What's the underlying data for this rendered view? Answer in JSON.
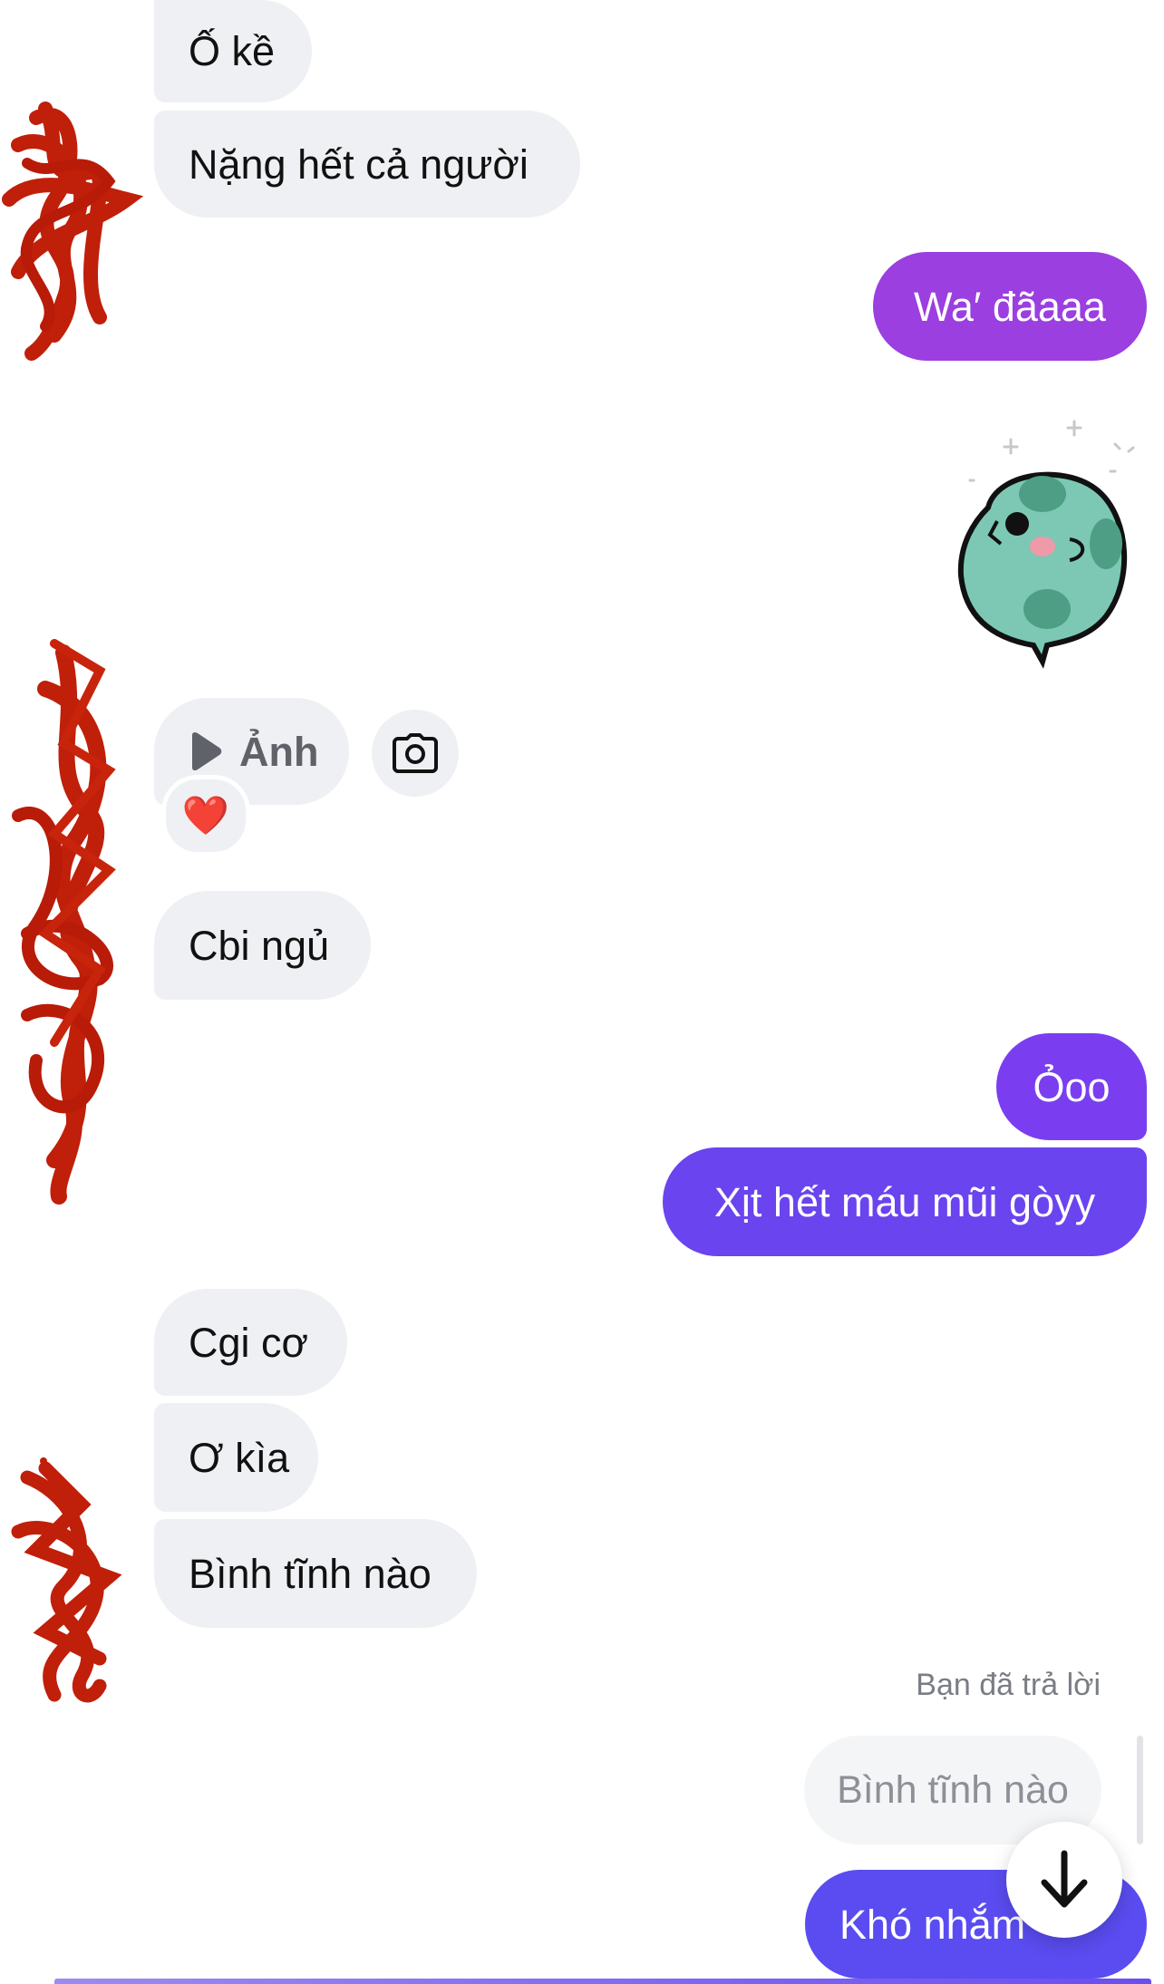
{
  "messages": {
    "m1": "Ố kề",
    "m2": "Nặng hết cả người",
    "m3": "Wa′ đãaaa",
    "m4_label": "Ảnh",
    "m5": "Cbi ngủ",
    "m6": "Ỏoo",
    "m7": "Xịt hết máu mũi gòyy",
    "m8": "Cgi cơ",
    "m9": "Ơ kìa",
    "m10": "Bình tĩnh nào",
    "m11": "Khó nhắm"
  },
  "reply": {
    "label": "Bạn đã trả lời",
    "quoted": "Bình tĩnh nào"
  },
  "reaction": {
    "emoji": "❤️"
  },
  "colors": {
    "incoming_bg": "#eff0f3",
    "outgoing_purple_1": "#9b3fe0",
    "outgoing_purple_2": "#7a3ef0",
    "outgoing_purple_3": "#5a4cf0",
    "scribble": "#c01f0a"
  },
  "icons": [
    "play-icon",
    "camera-icon",
    "arrow-down-icon",
    "sticker-dino"
  ]
}
